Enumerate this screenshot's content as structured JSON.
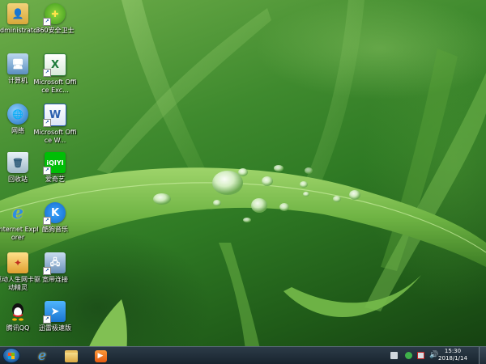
{
  "desktop_icons": [
    {
      "label": "Administrator",
      "icon": "user-folder-icon"
    },
    {
      "label": "360安全卫士",
      "icon": "360-security-icon"
    },
    {
      "label": "计算机",
      "icon": "computer-icon"
    },
    {
      "label": "Microsoft Office Exc...",
      "icon": "excel-icon"
    },
    {
      "label": "网络",
      "icon": "network-icon"
    },
    {
      "label": "Microsoft Office W...",
      "icon": "word-icon"
    },
    {
      "label": "回收站",
      "icon": "recycle-bin-icon"
    },
    {
      "label": "爱奇艺",
      "icon": "iqiyi-icon"
    },
    {
      "label": "Internet Explorer",
      "icon": "internet-explorer-icon"
    },
    {
      "label": "酷狗音乐",
      "icon": "kugou-icon"
    },
    {
      "label": "驱动人生网卡驱动精灵",
      "icon": "driver-icon"
    },
    {
      "label": "宽带连接",
      "icon": "broadband-icon"
    },
    {
      "label": "腾讯QQ",
      "icon": "qq-icon"
    },
    {
      "label": "迅雷极速版",
      "icon": "xunlei-icon"
    }
  ],
  "taskbar": {
    "pinned": [
      "internet-explorer-icon",
      "file-explorer-icon",
      "media-player-icon"
    ],
    "tray": [
      "keyboard-icon",
      "security-icon",
      "network-tray-icon",
      "volume-icon"
    ],
    "clock": {
      "time": "15:30",
      "date": "2018/1/14"
    }
  }
}
